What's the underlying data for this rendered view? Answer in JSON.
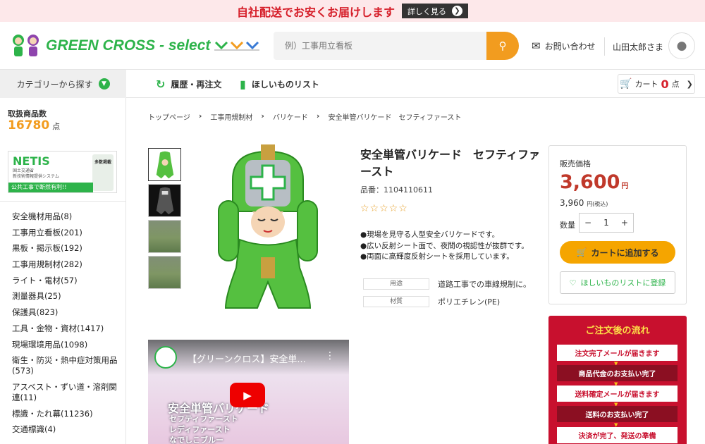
{
  "banner": {
    "text": "自社配送でお安くお届けします",
    "button": "詳しく見る"
  },
  "header": {
    "logo_text": "GREEN CROSS - select",
    "search_placeholder": "例）工事用立看板",
    "contact": "お問い合わせ",
    "user": "山田太郎さま"
  },
  "nav": {
    "category": "カテゴリーから探す",
    "history": "履歴・再注文",
    "wishlist": "ほしいものリスト",
    "cart_label": "カート",
    "cart_count": "0",
    "cart_unit": "点"
  },
  "sidebar": {
    "count_label": "取扱商品数",
    "count": "16780",
    "count_unit": "点",
    "netis": {
      "title": "NETIS",
      "sub1": "国土交通省",
      "sub2": "新技術情報提供システム",
      "bar": "公共工事で断然有利!!",
      "badge": "多数掲載"
    },
    "categories": [
      "安全機材用品(8)",
      "工事用立看板(201)",
      "黒板・掲示板(192)",
      "工事用規制材(282)",
      "ライト・電材(57)",
      "測量器具(25)",
      "保護具(823)",
      "工具・金物・資材(1417)",
      "現場環境用品(1098)",
      "衛生・防災・熱中症対策用品(573)",
      "アスベスト・ずい道・溶剤関連(11)",
      "標識・たれ幕(11236)",
      "交通標識(4)"
    ]
  },
  "breadcrumb": [
    "トップページ",
    "工事用規制材",
    "バリケード",
    "安全単管バリケード　セフティファースト"
  ],
  "product": {
    "title": "安全単管バリケード　セフティファースト",
    "code": "品番：1104110611",
    "stars": "☆☆☆☆☆",
    "description": [
      "●現場を見守る人型安全バリケードです。",
      "●広い反射シート面で、夜間の視認性が抜群です。",
      "●両面に高輝度反射シートを採用しています。"
    ],
    "specs": [
      {
        "k": "用途",
        "v": "道路工事での車線規制に。"
      },
      {
        "k": "材質",
        "v": "ポリエチレン(PE)"
      }
    ]
  },
  "video": {
    "title": "【グリーンクロス】安全単...",
    "caption": "安全単管バリケード",
    "sub1": "セフティファースト",
    "sub2": "レディファースト",
    "sub3": "なでしこブルー"
  },
  "price": {
    "label": "販売価格",
    "price": "3,600",
    "yen": "円",
    "tax_price": "3,960",
    "tax_label": "円(税込)",
    "qty_label": "数量",
    "qty": "1",
    "add_cart": "カートに追加する",
    "wishlist": "ほしいものリストに登録"
  },
  "flow": {
    "title": "ご注文後の流れ",
    "steps": [
      "注文完了メールが届きます",
      "商品代金のお支払い完了",
      "送料確定メールが届きます",
      "送料のお支払い完了",
      "決済が完了、発送の準備"
    ]
  },
  "colors": {
    "brand_green": "#2db34a",
    "accent_orange": "#f29c1f",
    "price_red": "#c0392b",
    "flow_red": "#c8102e"
  }
}
